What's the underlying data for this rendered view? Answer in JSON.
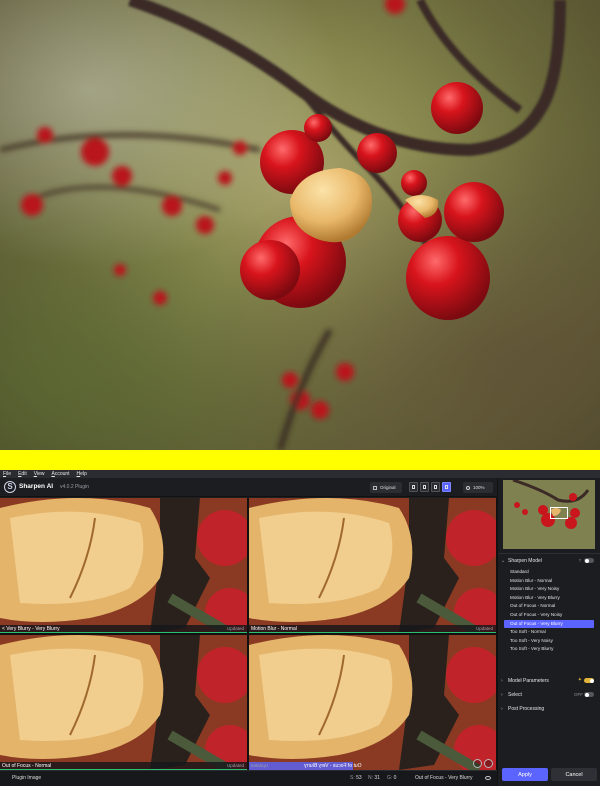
{
  "menu": {
    "items": [
      "File",
      "Edit",
      "View",
      "Account",
      "Help"
    ]
  },
  "header": {
    "app_name": "Sharpen AI",
    "version": "v4.0.2 Plugin",
    "original_label": "Original",
    "zoom": "100%"
  },
  "previews": [
    {
      "label": "< Very Blurry - Very Blurry",
      "status": "Updated"
    },
    {
      "label": "Motion Blur - Normal",
      "status": "Updated"
    },
    {
      "label": "Out of Focus - Normal",
      "status": "Updated"
    },
    {
      "label": "Out of Focus - Very Blurry",
      "status": "Updated"
    }
  ],
  "status": {
    "plugin_label": "Plugin Image",
    "s_key": "S:",
    "s_val": "53",
    "n_key": "N:",
    "n_val": "31",
    "g_key": "G:",
    "g_val": "0",
    "model": "Out of Focus - Very Blurry"
  },
  "sidebar": {
    "sharpen_model": {
      "title": "Sharpen Model",
      "help": "?"
    },
    "models": [
      "Standard",
      "Motion Blur - Normal",
      "Motion Blur - Very Noisy",
      "Motion Blur - Very Blurry",
      "Out of Focus - Normal",
      "Out of Focus - Very Noisy",
      "Out of Focus - Very Blurry",
      "Too Soft - Normal",
      "Too Soft - Very Noisy",
      "Too Soft - Very Blurry"
    ],
    "selected_model_index": 6,
    "model_parameters": {
      "title": "Model Parameters",
      "star": "✦"
    },
    "select": {
      "title": "Select",
      "state": "OFF"
    },
    "post_processing": {
      "title": "Post Processing"
    }
  },
  "buttons": {
    "apply": "Apply",
    "cancel": "Cancel"
  },
  "colors": {
    "accent": "#5b64ff",
    "toggle_on": "#e3b43a",
    "progress": "#2bbf72",
    "banner": "#ffff00"
  }
}
